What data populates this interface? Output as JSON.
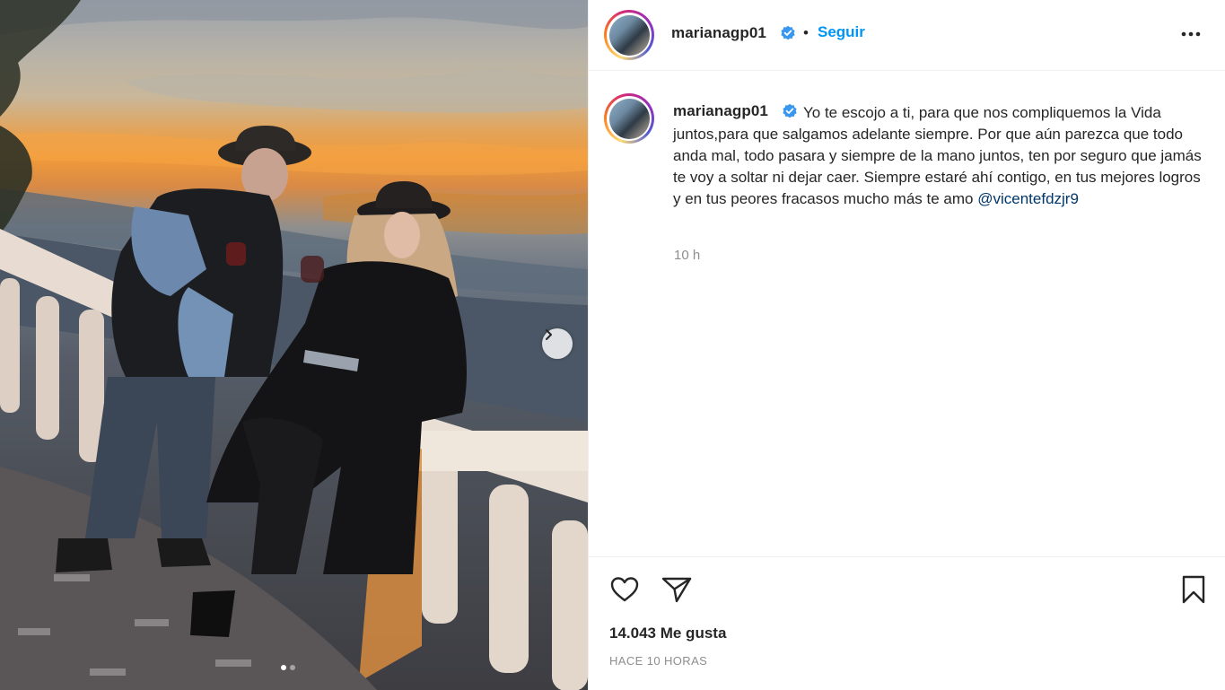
{
  "post": {
    "author": {
      "username": "marianagp01",
      "verified": true
    },
    "header": {
      "separator": "•",
      "follow_label": "Seguir"
    },
    "caption": {
      "username": "marianagp01",
      "text": "Yo te escojo a ti, para que nos compliquemos la Vida juntos,para que salgamos adelante siempre. Por que aún parezca que todo anda mal, todo pasara y siempre de la mano juntos, ten por seguro que jamás te voy a soltar ni dejar caer. Siempre estaré ahí contigo, en tus mejores logros y en tus peores fracasos mucho más te amo",
      "mention": "@vicentefdzjr9",
      "relative_time": "10 h"
    },
    "likes_text": "14.043 Me gusta",
    "posted_text": "HACE 10 HORAS",
    "carousel": {
      "total_slides": 2,
      "current_slide": 1
    },
    "colors": {
      "accent": "#0095f6",
      "verified": "#3897f0",
      "text": "#262626",
      "muted": "#8e8e8e",
      "mention": "#00376b",
      "divider": "#efefef"
    },
    "icons": {
      "more": "more-horizontal-icon",
      "next": "chevron-right-icon",
      "like": "heart-icon",
      "share": "paper-plane-icon",
      "save": "bookmark-icon",
      "verified": "verified-badge-icon"
    }
  }
}
